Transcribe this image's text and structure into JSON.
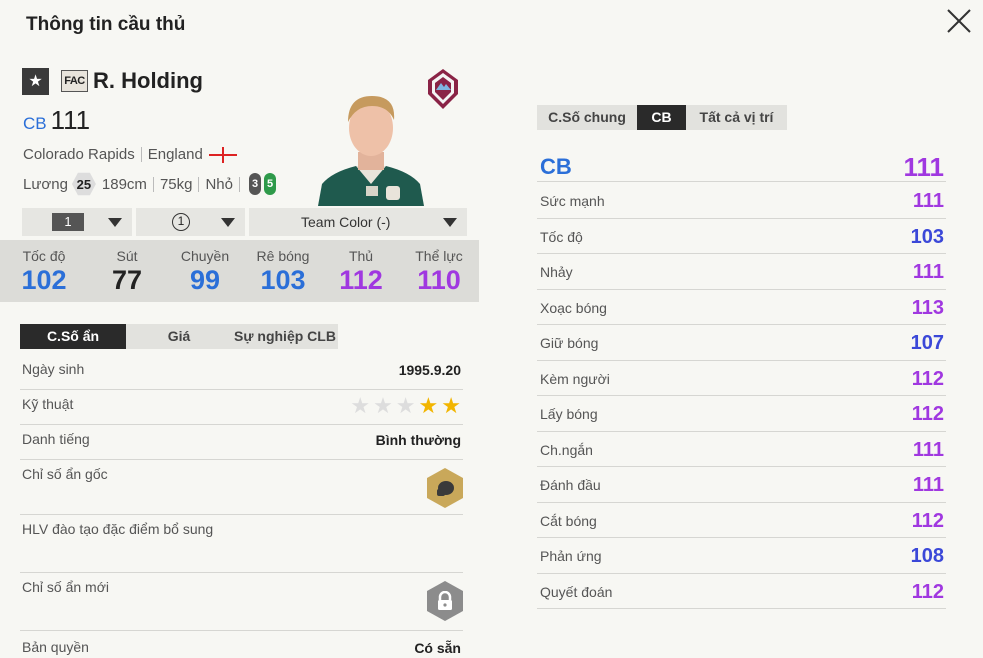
{
  "header": {
    "title": "Thông tin cầu thủ"
  },
  "player": {
    "name": "R. Holding",
    "season_badge": "FAC",
    "position": "CB",
    "overall": "111",
    "club": "Colorado Rapids",
    "nation": "England",
    "salary_label": "Lương",
    "salary": "25",
    "height": "189cm",
    "weight": "75kg",
    "body_type": "Nhỏ",
    "weak_foot_left": "3",
    "weak_foot_right": "5"
  },
  "selectors": {
    "level": "1",
    "grade": "1",
    "team_color": "Team Color (-)"
  },
  "summary_stats": [
    {
      "label": "Tốc độ",
      "value": "102",
      "color": "#2b6fd8"
    },
    {
      "label": "Sút",
      "value": "77",
      "color": "#222222"
    },
    {
      "label": "Chuyền",
      "value": "99",
      "color": "#2b6fd8"
    },
    {
      "label": "Rê bóng",
      "value": "103",
      "color": "#2b6fd8"
    },
    {
      "label": "Thủ",
      "value": "112",
      "color": "#a038e0"
    },
    {
      "label": "Thể lực",
      "value": "110",
      "color": "#a038e0"
    }
  ],
  "left_tabs": [
    "C.Số ẩn",
    "Giá",
    "Sự nghiệp CLB"
  ],
  "info": {
    "birth_label": "Ngày sinh",
    "birth_value": "1995.9.20",
    "skill_label": "Kỹ thuật",
    "skill_stars": 2,
    "reputation_label": "Danh tiếng",
    "reputation_value": "Bình thường",
    "trait_label": "Chỉ số ẩn gốc",
    "coach_label": "HLV đào tạo đặc điểm bổ sung",
    "new_trait_label": "Chỉ số ẩn mới",
    "license_label": "Bản quyền",
    "license_value": "Có sẵn"
  },
  "right_tabs": [
    "C.Số chung",
    "CB",
    "Tất cả vị trí"
  ],
  "position_rating": {
    "label": "CB",
    "value": "111"
  },
  "attributes": [
    {
      "label": "Sức mạnh",
      "value": "111",
      "color": "#a038e0"
    },
    {
      "label": "Tốc độ",
      "value": "103",
      "color": "#3b48d8"
    },
    {
      "label": "Nhảy",
      "value": "111",
      "color": "#a038e0"
    },
    {
      "label": "Xoạc bóng",
      "value": "113",
      "color": "#a038e0"
    },
    {
      "label": "Giữ bóng",
      "value": "107",
      "color": "#3b48d8"
    },
    {
      "label": "Kèm người",
      "value": "112",
      "color": "#a038e0"
    },
    {
      "label": "Lấy bóng",
      "value": "112",
      "color": "#a038e0"
    },
    {
      "label": "Ch.ngắn",
      "value": "111",
      "color": "#a038e0"
    },
    {
      "label": "Đánh đầu",
      "value": "111",
      "color": "#a038e0"
    },
    {
      "label": "Cắt bóng",
      "value": "112",
      "color": "#a038e0"
    },
    {
      "label": "Phản ứng",
      "value": "108",
      "color": "#3b48d8"
    },
    {
      "label": "Quyết đoán",
      "value": "112",
      "color": "#a038e0"
    }
  ]
}
